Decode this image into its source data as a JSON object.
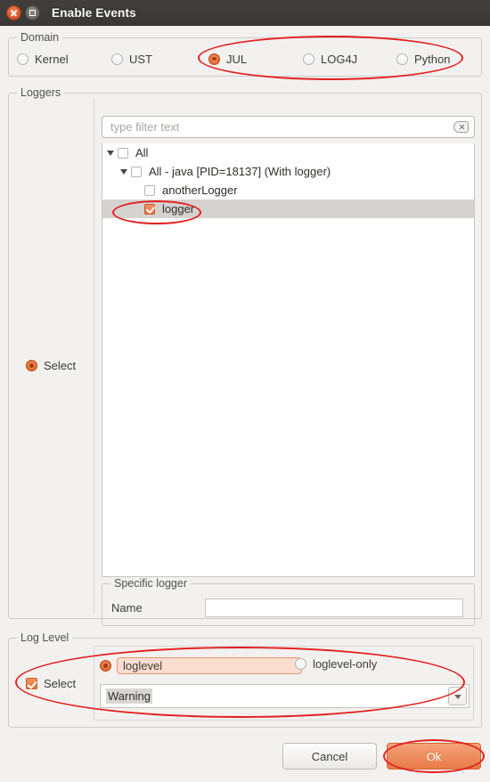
{
  "window": {
    "title": "Enable Events",
    "close_icon": "close-icon",
    "maximize_icon": "maximize-icon"
  },
  "domain": {
    "legend": "Domain",
    "options": [
      {
        "label": "Kernel",
        "selected": false
      },
      {
        "label": "UST",
        "selected": false
      },
      {
        "label": "JUL",
        "selected": true
      },
      {
        "label": "LOG4J",
        "selected": false
      },
      {
        "label": "Python",
        "selected": false
      }
    ]
  },
  "loggers": {
    "legend": "Loggers",
    "select_label": "Select",
    "select_checked": true,
    "filter": {
      "value": "",
      "placeholder": "type filter text",
      "clear_icon": "clear-icon"
    },
    "tree": [
      {
        "label": "All",
        "checked": false,
        "expanded": true,
        "indent": 0,
        "has_arrow": true,
        "selected": false
      },
      {
        "label": "All - java [PID=18137] (With logger)",
        "checked": false,
        "expanded": true,
        "indent": 1,
        "has_arrow": true,
        "selected": false
      },
      {
        "label": "anotherLogger",
        "checked": false,
        "expanded": false,
        "indent": 2,
        "has_arrow": false,
        "selected": false
      },
      {
        "label": "logger",
        "checked": true,
        "expanded": false,
        "indent": 2,
        "has_arrow": false,
        "selected": true
      }
    ],
    "specific": {
      "legend": "Specific logger",
      "name_label": "Name",
      "name_value": "",
      "name_placeholder": ""
    }
  },
  "log_level": {
    "legend": "Log Level",
    "select_label": "Select",
    "select_checked": true,
    "mode_options": [
      {
        "label": "loglevel",
        "selected": true
      },
      {
        "label": "loglevel-only",
        "selected": false
      }
    ],
    "combo_value": "Warning",
    "combo_arrow_icon": "chevron-down-icon"
  },
  "buttons": {
    "cancel": "Cancel",
    "ok": "Ok"
  },
  "colors": {
    "accent": "#e8713a",
    "annotation": "#e41f1f",
    "titlebar": "#3a3836",
    "dialog_bg": "#f2f1f0"
  }
}
